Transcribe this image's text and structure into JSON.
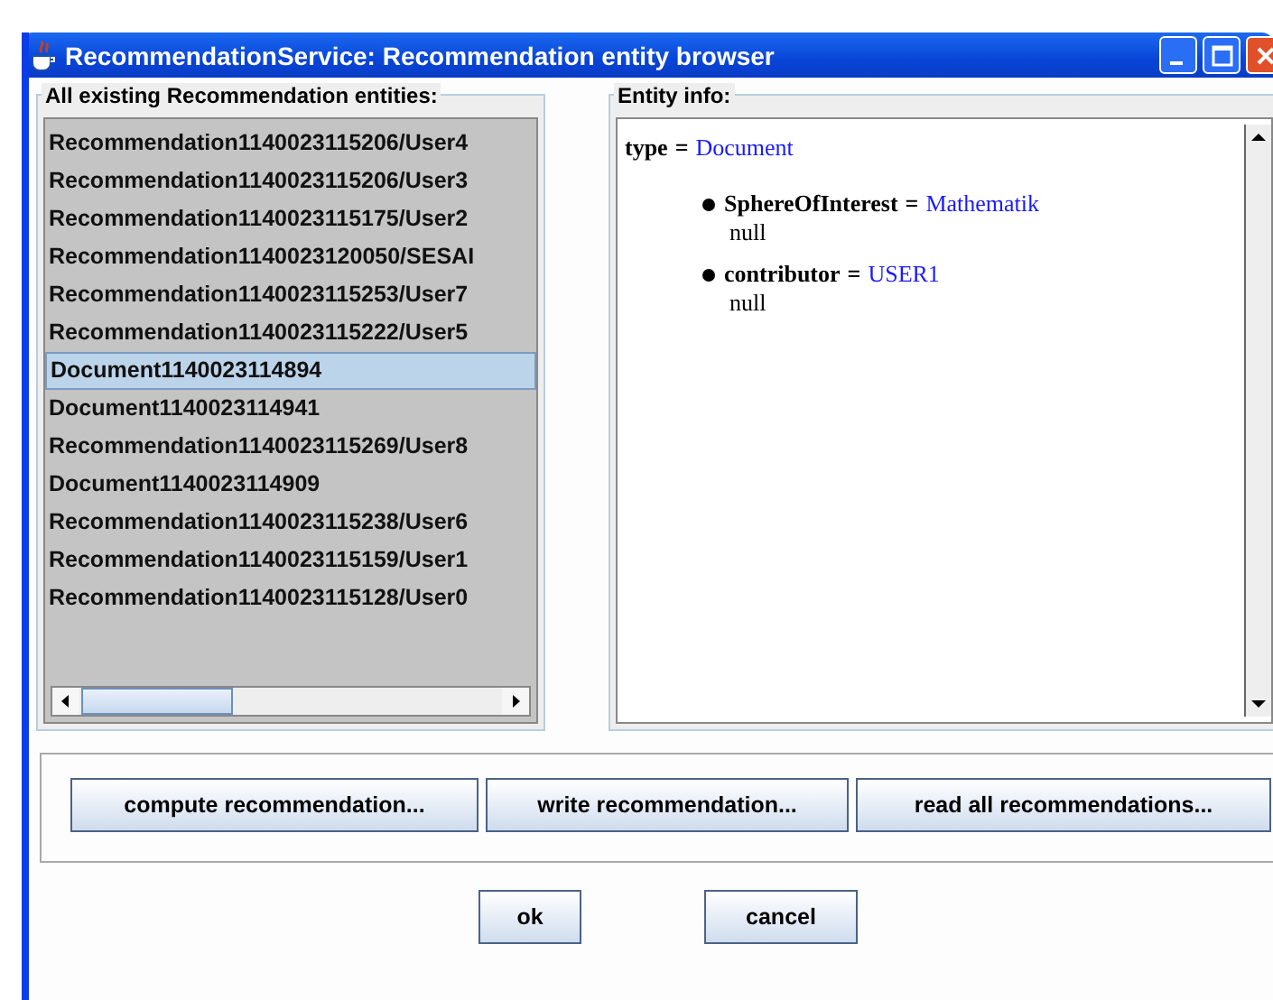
{
  "window": {
    "title": "RecommendationService: Recommendation entity browser"
  },
  "entities_panel": {
    "title": "All existing Recommendation entities:",
    "items": [
      {
        "label": "Recommendation1140023115206/User4",
        "selected": false
      },
      {
        "label": "Recommendation1140023115206/User3",
        "selected": false
      },
      {
        "label": "Recommendation1140023115175/User2",
        "selected": false
      },
      {
        "label": "Recommendation1140023120050/SESAI",
        "selected": false
      },
      {
        "label": "Recommendation1140023115253/User7",
        "selected": false
      },
      {
        "label": "Recommendation1140023115222/User5",
        "selected": false
      },
      {
        "label": "Document1140023114894",
        "selected": true
      },
      {
        "label": "Document1140023114941",
        "selected": false
      },
      {
        "label": "Recommendation1140023115269/User8",
        "selected": false
      },
      {
        "label": "Document1140023114909",
        "selected": false
      },
      {
        "label": "Recommendation1140023115238/User6",
        "selected": false
      },
      {
        "label": "Recommendation1140023115159/User1",
        "selected": false
      },
      {
        "label": "Recommendation1140023115128/User0",
        "selected": false
      }
    ]
  },
  "info_panel": {
    "title": "Entity info:",
    "type": {
      "name": "type",
      "sign": "=",
      "value": "Document"
    },
    "properties": [
      {
        "name": "SphereOfInterest",
        "sign": "=",
        "value": "Mathematik",
        "note": "null"
      },
      {
        "name": "contributor",
        "sign": "=",
        "value": "USER1",
        "note": "null"
      }
    ]
  },
  "actions": [
    "compute recommendation...",
    "write recommendation...",
    "read all recommendations..."
  ],
  "dialog_buttons": [
    "ok",
    "cancel"
  ]
}
